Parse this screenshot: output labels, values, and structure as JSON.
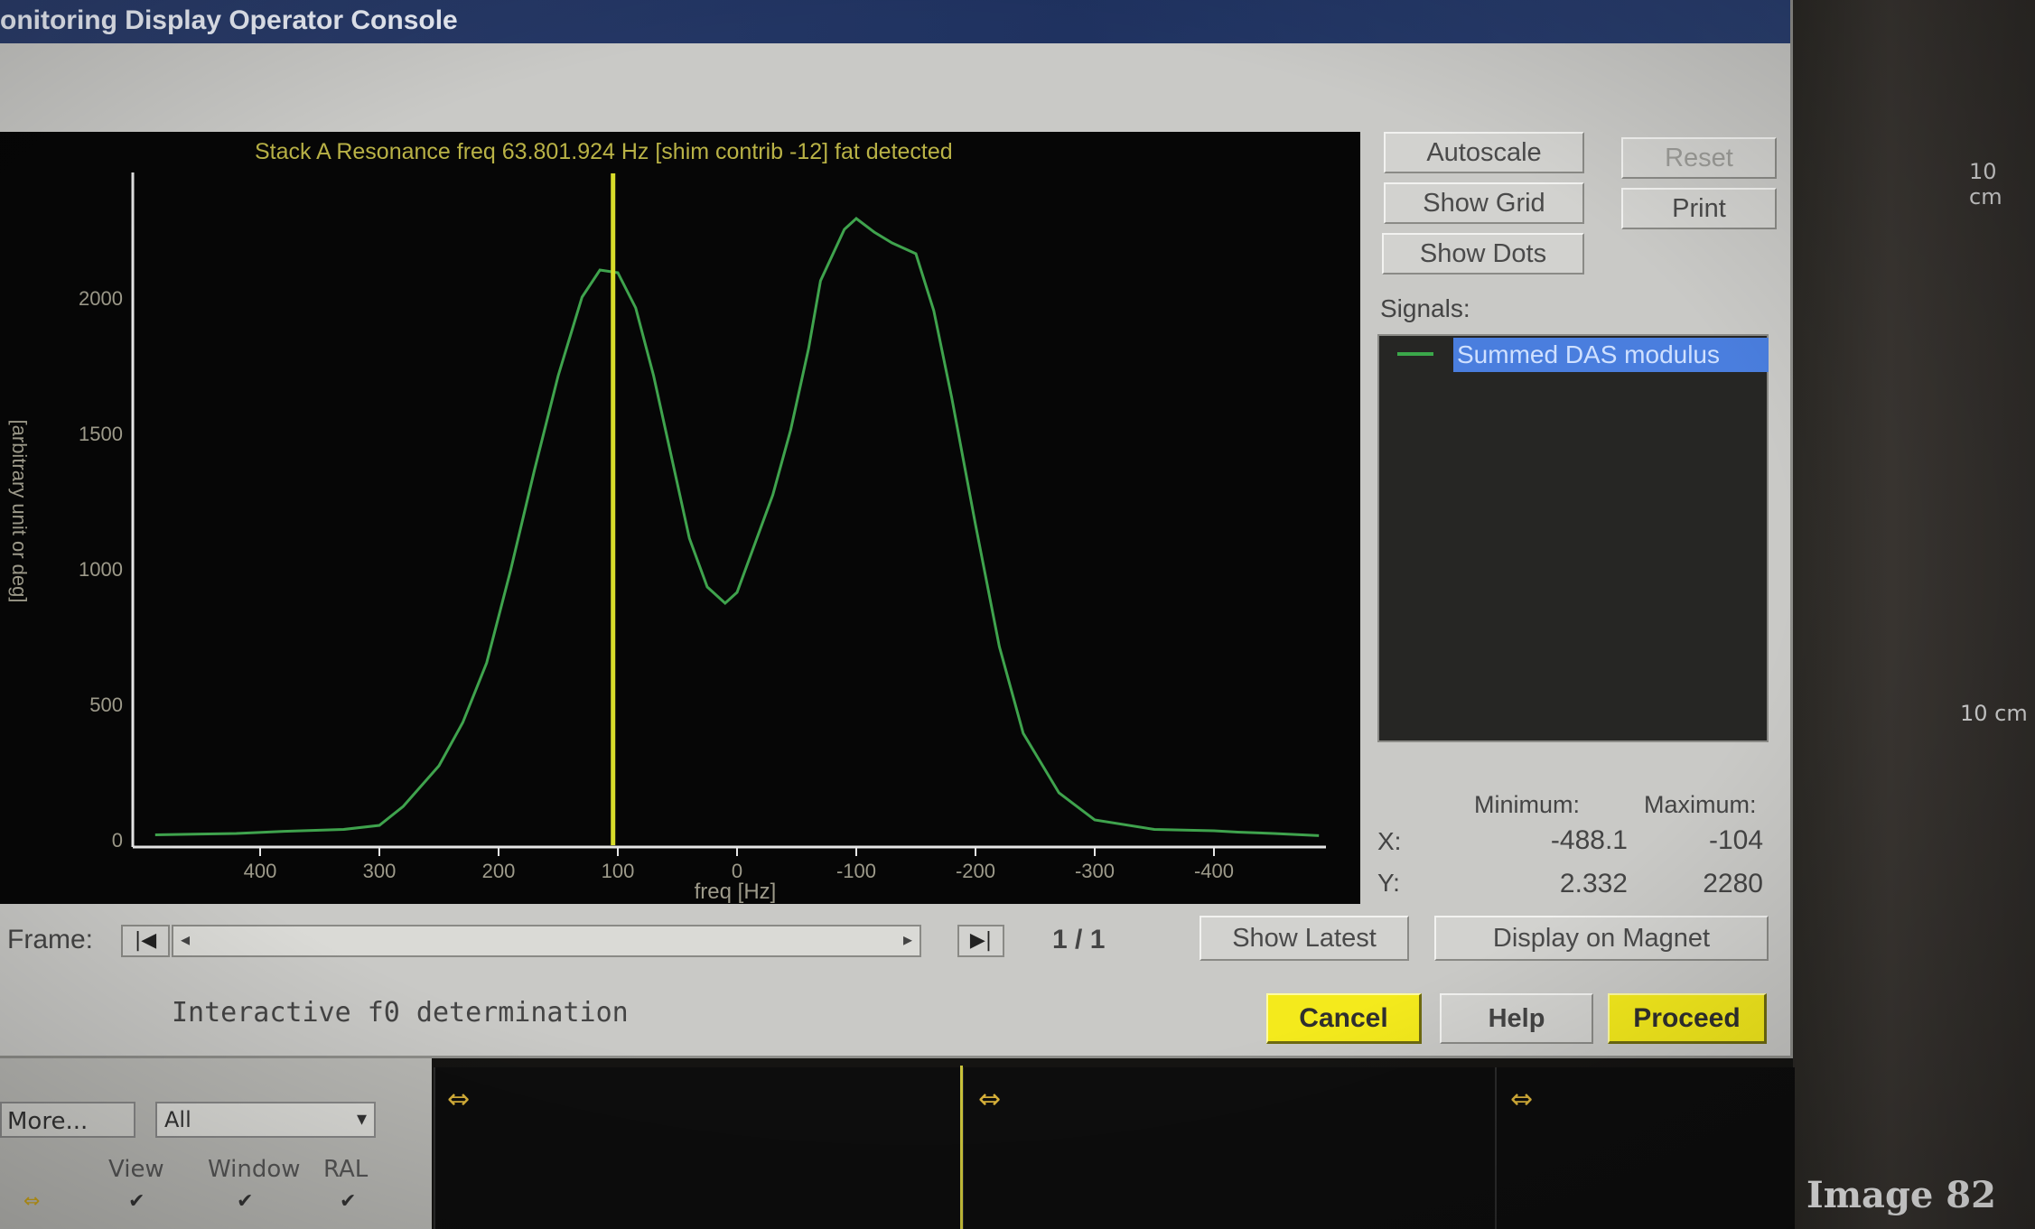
{
  "window": {
    "title": "onitoring Display Operator Console"
  },
  "plot": {
    "header": "Stack A Resonance freq 63.801.924 Hz [shim contrib -12] fat detected",
    "ylabel": "[arbitrary unit or deg]",
    "xlabel": "freq [Hz]"
  },
  "chart_data": {
    "type": "line",
    "xlabel": "freq [Hz]",
    "ylabel": "[arbitrary unit or deg]",
    "x_axis_reversed": true,
    "xlim": [
      500,
      -500
    ],
    "ylim": [
      0,
      2400
    ],
    "x_ticks": [
      {
        "value": 400,
        "label": "400"
      },
      {
        "value": 300,
        "label": "300"
      },
      {
        "value": 200,
        "label": "200"
      },
      {
        "value": 100,
        "label": "100"
      },
      {
        "value": 0,
        "label": "0"
      },
      {
        "value": -100,
        "label": "-100"
      },
      {
        "value": -200,
        "label": "-200"
      },
      {
        "value": -300,
        "label": "-300"
      },
      {
        "value": -400,
        "label": "-400"
      }
    ],
    "y_ticks": [
      {
        "value": 0,
        "label": "0"
      },
      {
        "value": 500,
        "label": "500"
      },
      {
        "value": 1000,
        "label": "1000"
      },
      {
        "value": 1500,
        "label": "1500"
      },
      {
        "value": 2000,
        "label": "2000"
      }
    ],
    "marker_line_x": 104,
    "series": [
      {
        "name": "Summed DAS modulus",
        "color": "#3fa34d",
        "points": [
          [
            -488,
            2
          ],
          [
            -450,
            10
          ],
          [
            -420,
            15
          ],
          [
            -400,
            20
          ],
          [
            -350,
            25
          ],
          [
            -300,
            60
          ],
          [
            -270,
            160
          ],
          [
            -240,
            380
          ],
          [
            -220,
            700
          ],
          [
            -200,
            1150
          ],
          [
            -180,
            1620
          ],
          [
            -165,
            1940
          ],
          [
            -150,
            2150
          ],
          [
            -130,
            2190
          ],
          [
            -115,
            2230
          ],
          [
            -100,
            2280
          ],
          [
            -90,
            2240
          ],
          [
            -70,
            2050
          ],
          [
            -60,
            1800
          ],
          [
            -45,
            1500
          ],
          [
            -30,
            1260
          ],
          [
            -15,
            1080
          ],
          [
            0,
            900
          ],
          [
            10,
            860
          ],
          [
            25,
            920
          ],
          [
            40,
            1100
          ],
          [
            55,
            1400
          ],
          [
            70,
            1700
          ],
          [
            85,
            1950
          ],
          [
            100,
            2080
          ],
          [
            115,
            2090
          ],
          [
            130,
            1990
          ],
          [
            150,
            1700
          ],
          [
            170,
            1350
          ],
          [
            190,
            980
          ],
          [
            210,
            640
          ],
          [
            230,
            420
          ],
          [
            250,
            260
          ],
          [
            280,
            110
          ],
          [
            300,
            40
          ],
          [
            330,
            25
          ],
          [
            380,
            18
          ],
          [
            420,
            10
          ],
          [
            450,
            8
          ],
          [
            488,
            5
          ]
        ]
      }
    ]
  },
  "buttons": {
    "autoscale": "Autoscale",
    "reset": "Reset",
    "show_grid": "Show Grid",
    "print": "Print",
    "show_dots": "Show Dots",
    "show_latest": "Show Latest",
    "display_on_magnet": "Display on Magnet",
    "cancel": "Cancel",
    "help": "Help",
    "proceed": "Proceed"
  },
  "signals": {
    "label": "Signals:",
    "items": [
      {
        "name": "Summed DAS modulus",
        "color": "#3ba84a"
      }
    ]
  },
  "ranges": {
    "min_label": "Minimum:",
    "max_label": "Maximum:",
    "x_label": "X:",
    "y_label": "Y:",
    "x_min": "-488.1",
    "x_max": "-104",
    "y_min": "2.332",
    "y_max": "2280"
  },
  "frame": {
    "label": "Frame:",
    "counter": "1 / 1"
  },
  "status": {
    "message": "Interactive f0 determination"
  },
  "background": {
    "more_label": "More...",
    "filter_value": "All",
    "col_view": "View",
    "col_window": "Window",
    "col_ral": "RAL",
    "scale_1": "10 cm",
    "scale_2": "10 cm",
    "image_label": "Image 82"
  },
  "colors": {
    "accent_yellow": "#f4ea1c",
    "title_bar": "#1f3260",
    "curve_green": "#3fa34d",
    "marker_yellow": "#d8dc2a",
    "selection_blue": "#4a7ede"
  }
}
